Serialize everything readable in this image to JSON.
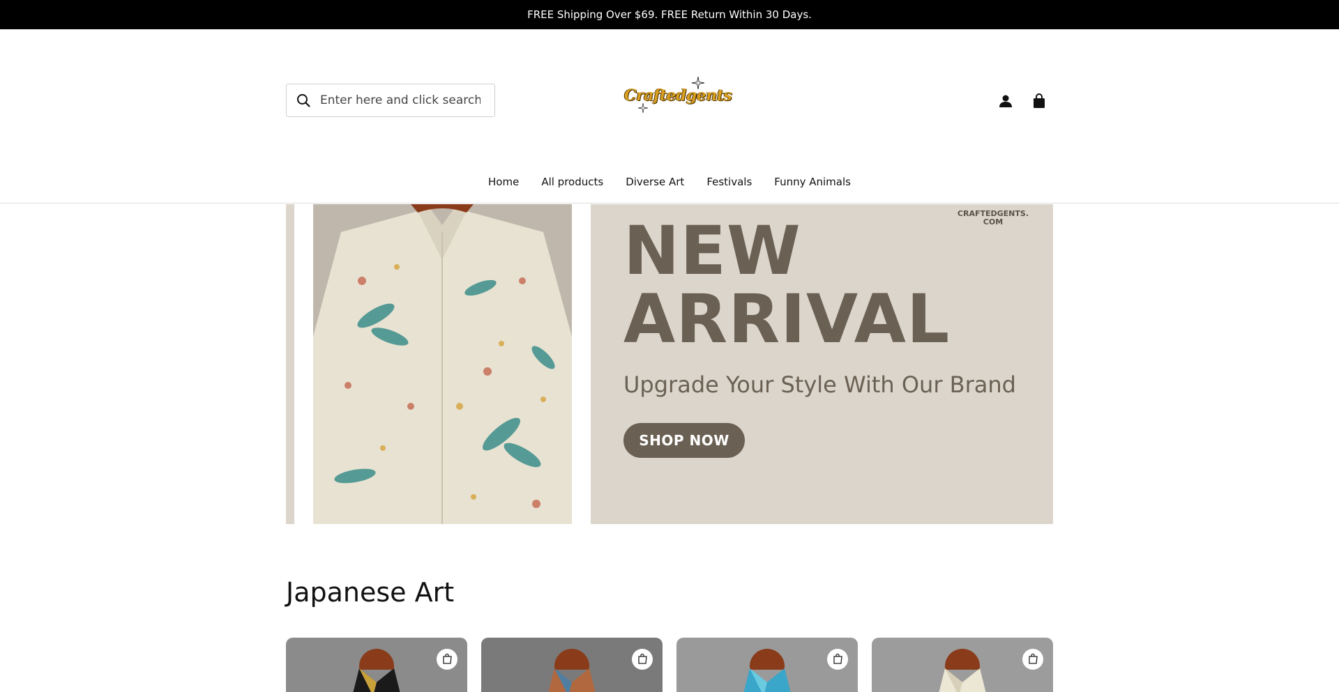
{
  "announcement": "FREE Shipping Over $69. FREE Return Within 30 Days.",
  "search": {
    "placeholder": "Enter here and click search"
  },
  "logo": {
    "text": "Craftedgents"
  },
  "nav": [
    "Home",
    "All products",
    "Diverse Art",
    "Festivals",
    "Funny Animals"
  ],
  "hero": {
    "brand_small_line1": "CRAFTEDGENTS.",
    "brand_small_line2": "COM",
    "title_line1": "NEW",
    "title_line2": "ARRIVAL",
    "subtitle": "Upgrade Your Style With Our Brand",
    "button": "SHOP NOW"
  },
  "section": {
    "title": "Japanese Art"
  },
  "colors": {
    "announce_bg": "#000000",
    "hero_bg": "#dcd5cb",
    "hero_text": "#6a6053",
    "logo_gold": "#d9a021"
  },
  "icons": [
    "search-icon",
    "user-icon",
    "shopping-bag-icon",
    "add-to-cart-icon"
  ]
}
